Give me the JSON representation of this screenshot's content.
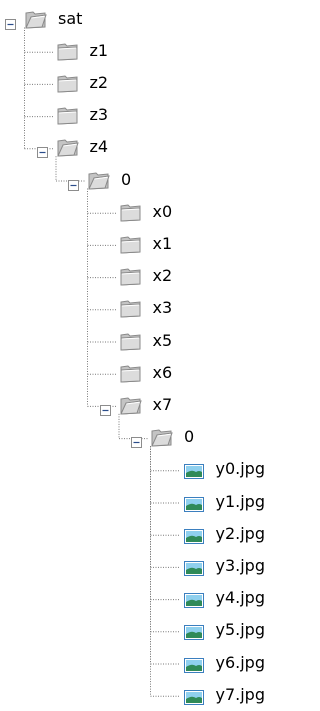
{
  "tree": {
    "label": "sat",
    "expanded": true,
    "icon": "folder-open-icon",
    "children": [
      {
        "label": "z1",
        "expanded": false,
        "icon": "folder-icon"
      },
      {
        "label": "z2",
        "expanded": false,
        "icon": "folder-icon"
      },
      {
        "label": "z3",
        "expanded": false,
        "icon": "folder-icon"
      },
      {
        "label": "z4",
        "expanded": true,
        "icon": "folder-open-icon",
        "children": [
          {
            "label": "0",
            "expanded": true,
            "icon": "folder-open-icon",
            "children": [
              {
                "label": "x0",
                "expanded": false,
                "icon": "folder-icon"
              },
              {
                "label": "x1",
                "expanded": false,
                "icon": "folder-icon"
              },
              {
                "label": "x2",
                "expanded": false,
                "icon": "folder-icon"
              },
              {
                "label": "x3",
                "expanded": false,
                "icon": "folder-icon"
              },
              {
                "label": "x5",
                "expanded": false,
                "icon": "folder-icon"
              },
              {
                "label": "x6",
                "expanded": false,
                "icon": "folder-icon"
              },
              {
                "label": "x7",
                "expanded": true,
                "icon": "folder-open-icon",
                "children": [
                  {
                    "label": "0",
                    "expanded": true,
                    "icon": "folder-open-icon",
                    "children": [
                      {
                        "label": "y0.jpg",
                        "icon": "image-file-icon"
                      },
                      {
                        "label": "y1.jpg",
                        "icon": "image-file-icon"
                      },
                      {
                        "label": "y2.jpg",
                        "icon": "image-file-icon"
                      },
                      {
                        "label": "y3.jpg",
                        "icon": "image-file-icon"
                      },
                      {
                        "label": "y4.jpg",
                        "icon": "image-file-icon"
                      },
                      {
                        "label": "y5.jpg",
                        "icon": "image-file-icon"
                      },
                      {
                        "label": "y6.jpg",
                        "icon": "image-file-icon"
                      },
                      {
                        "label": "y7.jpg",
                        "icon": "image-file-icon"
                      }
                    ]
                  }
                ]
              }
            ]
          }
        ]
      }
    ]
  },
  "colors": {
    "folder_fill": "#dcdcdc",
    "folder_stroke": "#8a8a8a",
    "image_frame": "#3b7fbf",
    "image_sky": "#8fd0ee",
    "image_hill": "#2f8a58",
    "toggle_border": "#8c8c8c",
    "toggle_sign": "#2a4c8a",
    "tree_line": "#7a7a7a"
  }
}
